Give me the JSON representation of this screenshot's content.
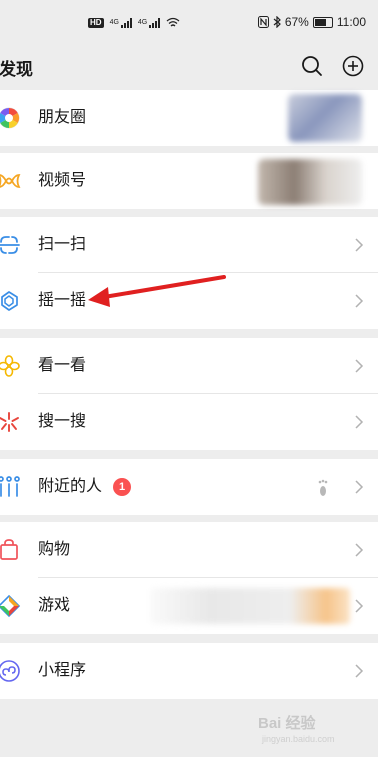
{
  "status_bar": {
    "hd_label": "HD",
    "network_1": "4G",
    "network_2": "4G",
    "battery_percent": "67%",
    "time": "11:00"
  },
  "header": {
    "title": "发现"
  },
  "menu": {
    "moments": {
      "label": "朋友圈",
      "icon": "moments-icon"
    },
    "channels": {
      "label": "视频号",
      "icon": "channels-icon"
    },
    "scan": {
      "label": "扫一扫",
      "icon": "scan-icon"
    },
    "shake": {
      "label": "摇一摇",
      "icon": "shake-icon"
    },
    "top_stories": {
      "label": "看一看",
      "icon": "top-stories-icon"
    },
    "search": {
      "label": "搜一搜",
      "icon": "search-feature-icon"
    },
    "nearby": {
      "label": "附近的人",
      "icon": "people-nearby-icon",
      "badge": "1"
    },
    "shopping": {
      "label": "购物",
      "icon": "shopping-bag-icon"
    },
    "games": {
      "label": "游戏",
      "icon": "games-icon"
    },
    "mini_programs": {
      "label": "小程序",
      "icon": "mini-programs-icon"
    }
  },
  "watermark": {
    "text": "Bai 经验",
    "sub": "jingyan.baidu.com"
  },
  "colors": {
    "background": "#ededed",
    "badge": "#fa5151",
    "annotation_arrow": "#e02020"
  }
}
